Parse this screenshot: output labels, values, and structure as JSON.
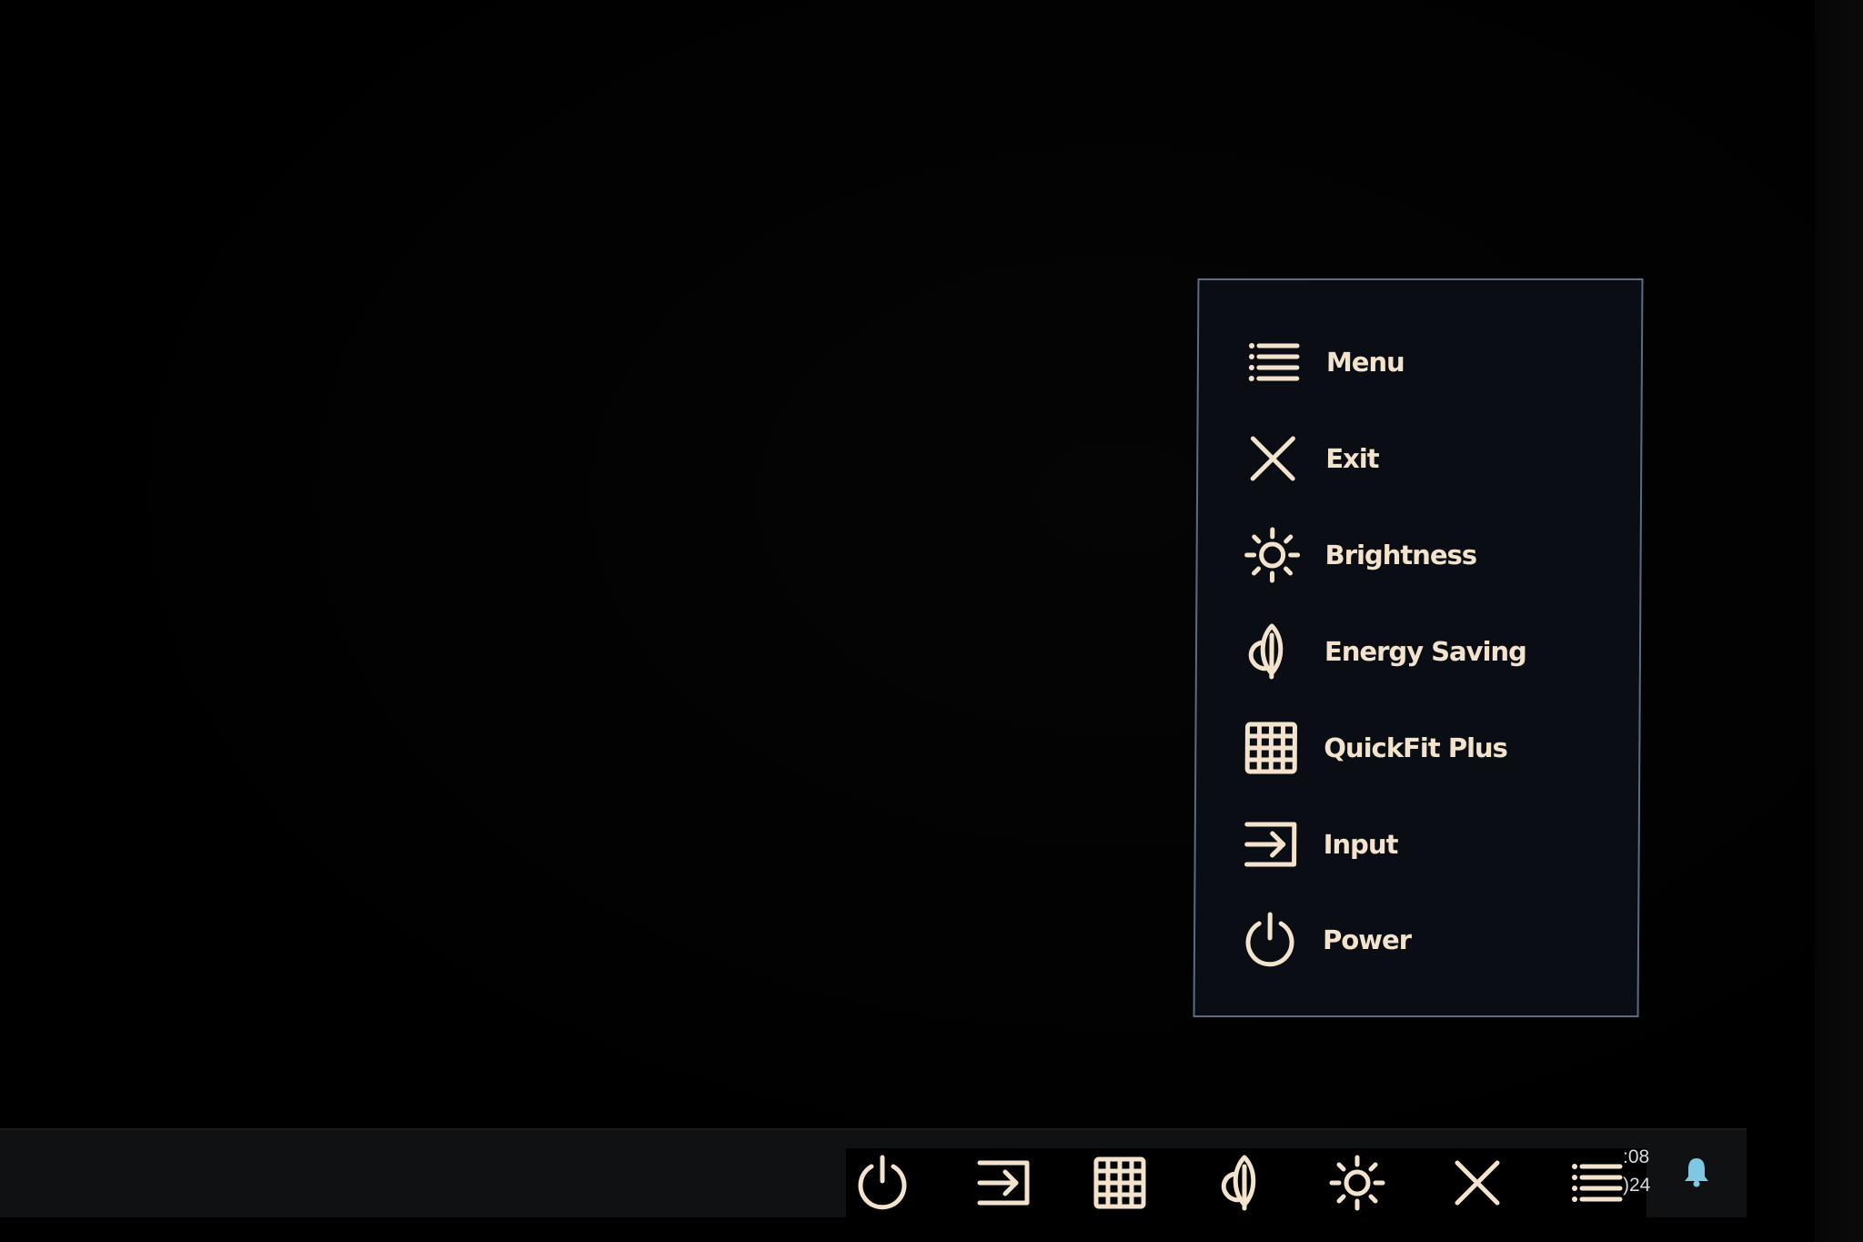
{
  "osd_menu": {
    "items": [
      {
        "label": "Menu",
        "icon": "menu-list-icon"
      },
      {
        "label": "Exit",
        "icon": "close-icon"
      },
      {
        "label": "Brightness",
        "icon": "sun-icon"
      },
      {
        "label": "Energy Saving",
        "icon": "leaf-icon"
      },
      {
        "label": "QuickFit Plus",
        "icon": "grid-icon"
      },
      {
        "label": "Input",
        "icon": "input-arrow-icon"
      },
      {
        "label": "Power",
        "icon": "power-icon"
      }
    ]
  },
  "hotkeys": {
    "items": [
      {
        "icon": "power-icon"
      },
      {
        "icon": "input-arrow-icon"
      },
      {
        "icon": "grid-icon"
      },
      {
        "icon": "leaf-icon"
      },
      {
        "icon": "sun-icon"
      },
      {
        "icon": "close-icon"
      },
      {
        "icon": "menu-list-icon"
      }
    ]
  },
  "taskbar": {
    "time": ":08",
    "date": ")24",
    "notification_icon": "bell-icon"
  },
  "colors": {
    "background": "#000000",
    "osd_panel": "#0a0e14",
    "osd_border": "#5b6b86",
    "icon_text": "#f3e3cc",
    "taskbar": "#101112",
    "bell": "#7ec8e3"
  }
}
